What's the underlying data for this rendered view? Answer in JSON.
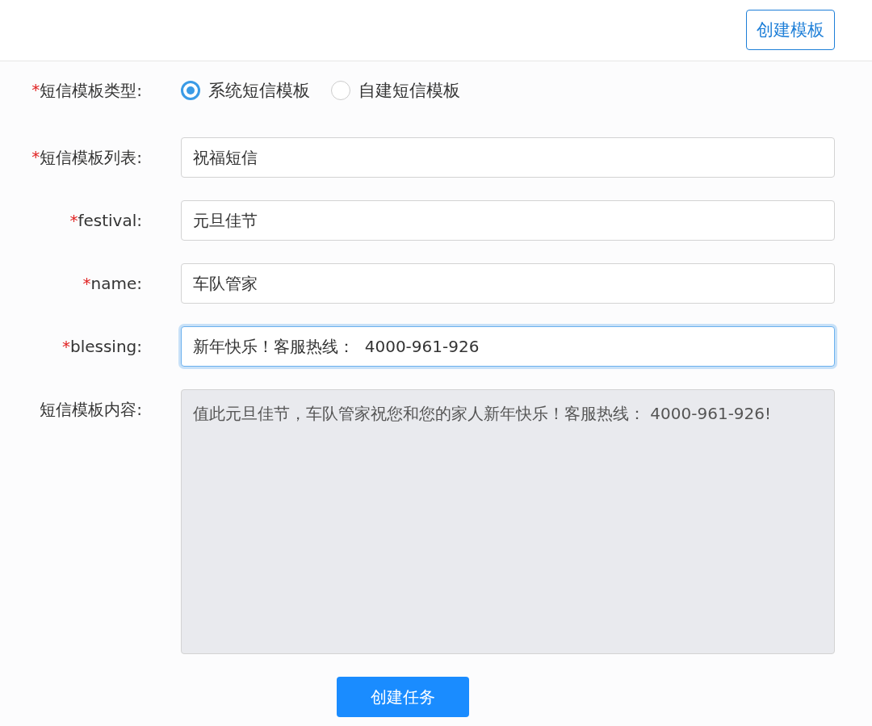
{
  "header": {
    "create_template_button": "创建模板"
  },
  "form": {
    "type_row": {
      "label": "短信模板类型:",
      "required_mark": "*",
      "options": [
        {
          "label": "系统短信模板",
          "selected": true
        },
        {
          "label": "自建短信模板",
          "selected": false
        }
      ]
    },
    "fields": [
      {
        "label": "短信模板列表:",
        "required_mark": "*",
        "value": "祝福短信",
        "focused": false
      },
      {
        "label": "festival:",
        "required_mark": "*",
        "value": "元旦佳节",
        "focused": false
      },
      {
        "label": "name:",
        "required_mark": "*",
        "value": "车队管家",
        "focused": false
      },
      {
        "label": "blessing:",
        "required_mark": "*",
        "value": "新年快乐！客服热线：  4000-961-926",
        "focused": true
      }
    ],
    "content": {
      "label": "短信模板内容:",
      "value": "值此元旦佳节，车队管家祝您和您的家人新年快乐！客服热线：  4000-961-926!",
      "disabled": true
    },
    "submit_button": "创建任务"
  }
}
